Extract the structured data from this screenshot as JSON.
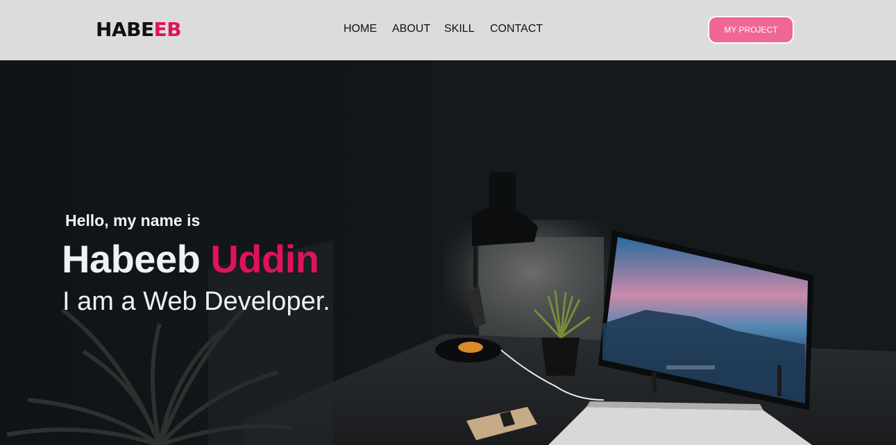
{
  "header": {
    "logo_main": "HABE",
    "logo_accent": "EB",
    "nav": [
      {
        "label": "HOME"
      },
      {
        "label": "ABOUT"
      },
      {
        "label": "SKILL"
      },
      {
        "label": "CONTACT"
      }
    ],
    "cta_label": "MY PROJECT"
  },
  "hero": {
    "greeting": "Hello, my name is",
    "first_name": "Habeeb",
    "last_name": "Uddin",
    "role": "I am a Web Developer.",
    "background_icons": [
      "desk-lamp-icon",
      "monitor-icon",
      "plant-icon",
      "laptop-icon",
      "notebook-icon"
    ]
  },
  "colors": {
    "accent": "#e0125a",
    "button": "#ef6795",
    "header_bg": "#dcdcdc",
    "hero_bg": "#121618"
  }
}
